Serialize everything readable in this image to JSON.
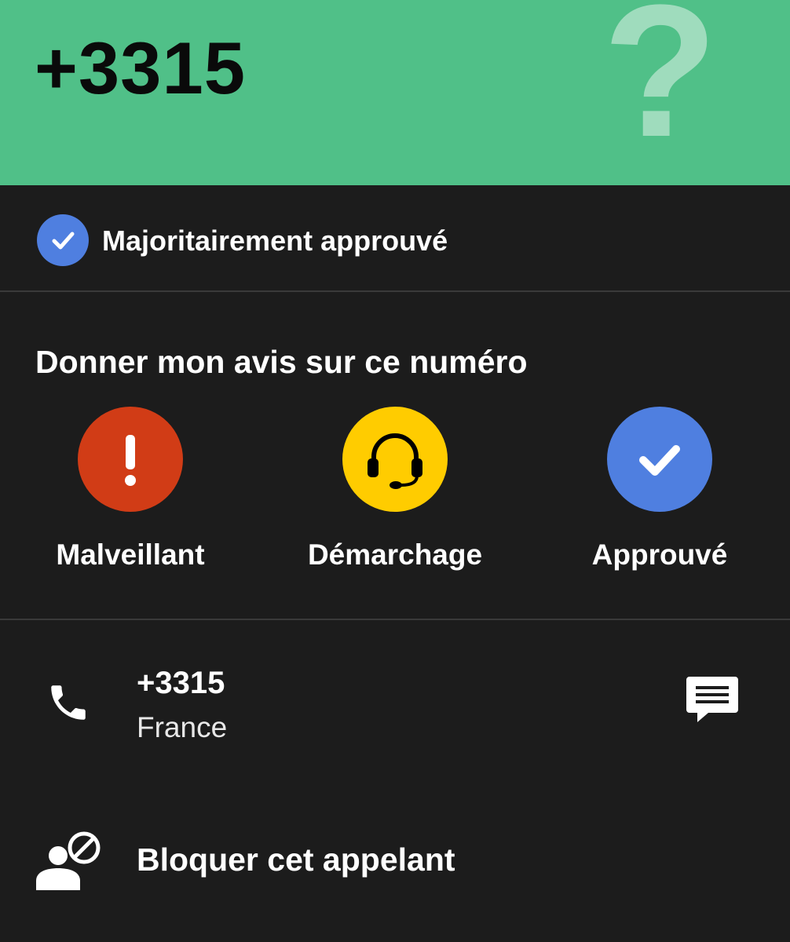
{
  "header": {
    "number": "+3315",
    "question_mark": "?",
    "background_color": "#50c088"
  },
  "status": {
    "icon": "check-circle-icon",
    "text": "Majoritairement approuvé",
    "color": "#4f7fe0"
  },
  "rating": {
    "title": "Donner mon avis sur ce numéro",
    "options": [
      {
        "label": "Malveillant",
        "icon": "exclamation-icon",
        "color": "#d13c16"
      },
      {
        "label": "Démarchage",
        "icon": "headset-icon",
        "color": "#ffcc00"
      },
      {
        "label": "Approuvé",
        "icon": "check-icon",
        "color": "#4f7fe0"
      }
    ]
  },
  "contact": {
    "number": "+3315",
    "country": "France",
    "call_icon": "phone-icon",
    "message_icon": "message-icon"
  },
  "block": {
    "label": "Bloquer cet appelant",
    "icon": "block-user-icon"
  }
}
